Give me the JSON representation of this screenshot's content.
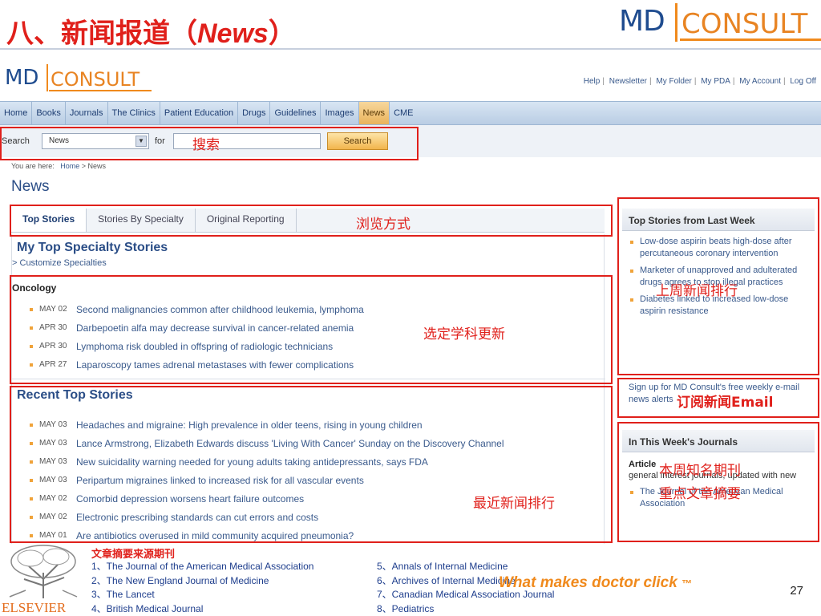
{
  "slide": {
    "title_cn": "八、新闻报道（",
    "title_en": "News",
    "title_end": "）",
    "logo_md": "MD",
    "logo_consult": "CONSULT",
    "page_number": "27",
    "tagline": "What makes doctor click",
    "tagline_tm": "™"
  },
  "site": {
    "logo_md": "MD",
    "logo_consult": "CONSULT",
    "top_links": [
      "Help",
      "Newsletter",
      "My Folder",
      "My PDA",
      "My Account",
      "Log Off"
    ],
    "nav": [
      "Home",
      "Books",
      "Journals",
      "The Clinics",
      "Patient Education",
      "Drugs",
      "Guidelines",
      "Images",
      "News",
      "CME"
    ],
    "nav_active": "News",
    "search": {
      "label": "Search",
      "selected": "News",
      "for_label": "for",
      "button": "Search"
    },
    "breadcrumb": {
      "prefix": "You are here:",
      "home": "Home",
      "sep": ">",
      "current": "News"
    },
    "page_title": "News",
    "tabs": [
      "Top Stories",
      "Stories By Specialty",
      "Original Reporting"
    ],
    "my_top": {
      "title": "My Top Specialty Stories",
      "customize_prefix": ">",
      "customize": "Customize Specialties",
      "specialty": "Oncology",
      "stories": [
        {
          "date": "MAY 02",
          "headline": "Second malignancies common after childhood leukemia, lymphoma"
        },
        {
          "date": "APR 30",
          "headline": "Darbepoetin alfa may decrease survival in cancer-related anemia"
        },
        {
          "date": "APR 30",
          "headline": "Lymphoma risk doubled in offspring of radiologic technicians"
        },
        {
          "date": "APR 27",
          "headline": "Laparoscopy tames adrenal metastases with fewer complications"
        }
      ]
    },
    "recent": {
      "title": "Recent Top Stories",
      "stories": [
        {
          "date": "MAY 03",
          "headline": "Headaches and migraine: High prevalence in older teens, rising in young children"
        },
        {
          "date": "MAY 03",
          "headline": "Lance Armstrong, Elizabeth Edwards discuss 'Living With Cancer' Sunday on the Discovery Channel"
        },
        {
          "date": "MAY 03",
          "headline": "New suicidality warning needed for young adults taking antidepressants, says FDA"
        },
        {
          "date": "MAY 03",
          "headline": "Peripartum migraines linked to increased risk for all vascular events"
        },
        {
          "date": "MAY 02",
          "headline": "Comorbid depression worsens heart failure outcomes"
        },
        {
          "date": "MAY 02",
          "headline": "Electronic prescribing standards can cut errors and costs"
        },
        {
          "date": "MAY 01",
          "headline": "Are antibiotics overused in mild community acquired pneumonia?"
        }
      ]
    },
    "last_week": {
      "title": "Top Stories from Last Week",
      "items": [
        "Low-dose aspirin beats high-dose after percutaneous coronary intervention",
        "Marketer of unapproved and adulterated drugs agrees to stop illegal practices",
        "Diabetes linked to increased low-dose aspirin resistance"
      ]
    },
    "signup": "Sign up for MD Consult's free weekly e-mail news alerts",
    "journals": {
      "title": "In This Week's Journals",
      "article_lead": "Article",
      "article_text": "general interest journals, updated with new",
      "items": [
        "The Journal of the American Medical Association"
      ]
    }
  },
  "annotations": {
    "search": "搜索",
    "browse": "浏览方式",
    "last_week": "上周新闻排行",
    "specialty": "选定学科更新",
    "email": "订阅新闻Email",
    "journals_1": "本周知名期刊",
    "journals_2": "重点文章摘要",
    "recent": "最近新闻排行"
  },
  "sources": {
    "title": "文章摘要来源期刊",
    "left": [
      "1、The Journal of the American Medical Association",
      "2、The New England Journal of Medicine",
      "3、The Lancet",
      "4、British Medical Journal"
    ],
    "right": [
      "5、Annals of Internal Medicine",
      "6、Archives of Internal Medicine",
      "7、Canadian Medical Association Journal",
      "8、Pediatrics"
    ],
    "publisher": "ELSEVIER"
  },
  "colors": {
    "accent_red": "#e0201b",
    "brand_orange": "#f08a1d",
    "link_blue": "#3a5a8c"
  }
}
